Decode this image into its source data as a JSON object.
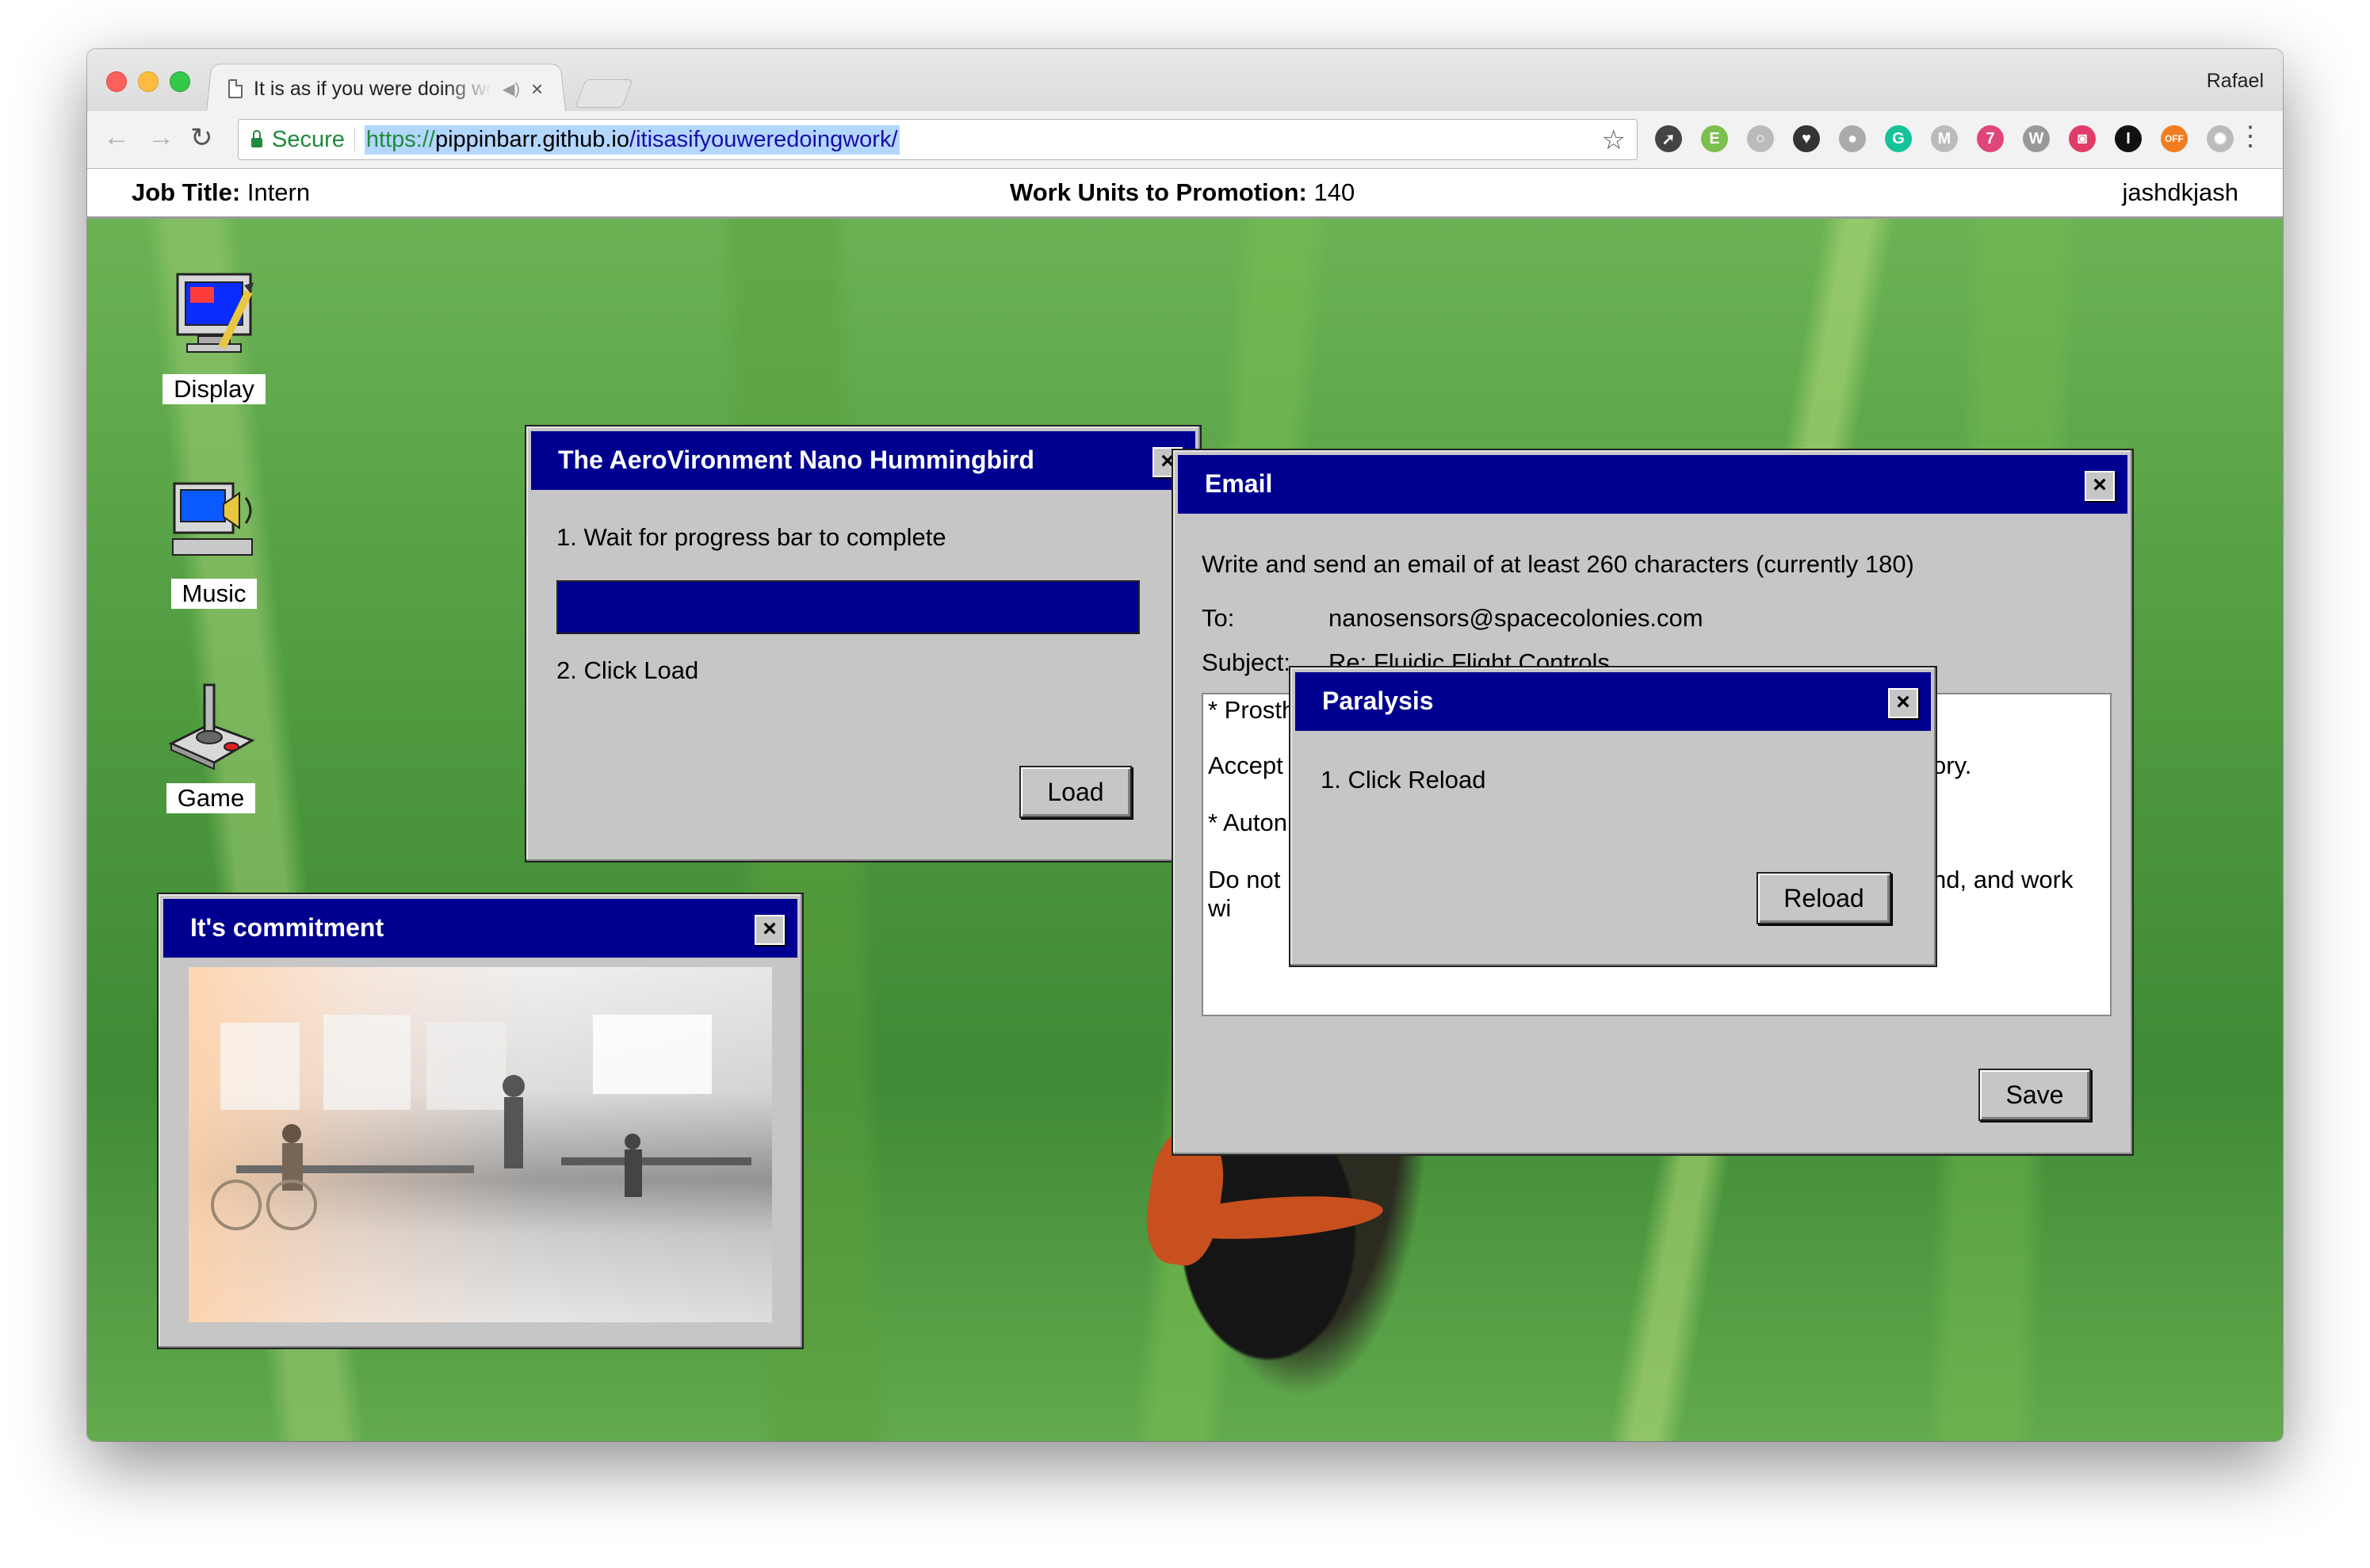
{
  "browser": {
    "tab_title": "It is as if you were doing work",
    "tab_close": "×",
    "profile_name": "Rafael",
    "secure_label": "Secure",
    "url_scheme": "https://",
    "url_host": "pippinbarr.github.io",
    "url_path": "/itisasifyouweredoingwork/",
    "extensions": [
      {
        "name": "rocket-icon",
        "color": "#444444",
        "glyph": "➚"
      },
      {
        "name": "evernote-icon",
        "color": "#7bbf4c",
        "glyph": "E"
      },
      {
        "name": "circle-ext-icon",
        "color": "#bbbbbb",
        "glyph": "○"
      },
      {
        "name": "pocket-icon",
        "color": "#333333",
        "glyph": "♥"
      },
      {
        "name": "dot-ext-icon",
        "color": "#aaaaaa",
        "glyph": "●"
      },
      {
        "name": "grammarly-icon",
        "color": "#15c39a",
        "glyph": "G"
      },
      {
        "name": "m-ext-icon",
        "color": "#bbbbbb",
        "glyph": "M"
      },
      {
        "name": "seven-ext-icon",
        "color": "#e0457b",
        "glyph": "7"
      },
      {
        "name": "wikipedia-icon",
        "color": "#999999",
        "glyph": "W"
      },
      {
        "name": "camera-ext-icon",
        "color": "#e03c67",
        "glyph": "◙"
      },
      {
        "name": "instapaper-icon",
        "color": "#111111",
        "glyph": "I"
      },
      {
        "name": "off-ext-icon",
        "color": "#f07d20",
        "glyph": "OFF"
      },
      {
        "name": "gear-ext-icon",
        "color": "#bbbbbb",
        "glyph": "✺"
      }
    ]
  },
  "status": {
    "job_title_label": "Job Title:",
    "job_title": "Intern",
    "units_label": "Work Units to Promotion:",
    "units_value": "140",
    "username": "jashdkjash"
  },
  "desktop_icons": [
    {
      "label": "Display"
    },
    {
      "label": "Music"
    },
    {
      "label": "Game"
    }
  ],
  "windows": {
    "hummingbird": {
      "title": "The AeroVironment Nano Hummingbird",
      "step1": "1. Wait for progress bar to complete",
      "progress": 1.0,
      "step2": "2. Click Load",
      "button": "Load"
    },
    "email": {
      "title": "Email",
      "instructions": "Write and send an email of at least 260 characters (currently 180)",
      "to_label": "To:",
      "to_value": "nanosensors@spacecolonies.com",
      "subject_label": "Subject:",
      "subject_value": "Re: Fluidic Flight Controls",
      "body_line1": "* Prosth",
      "body_line2a": "Accept",
      "body_line2b": "ory.",
      "body_line3": "* Auton",
      "body_line4a": "Do not",
      "body_line4b": "nd, and work",
      "body_line5": "wi",
      "button": "Save"
    },
    "paralysis": {
      "title": "Paralysis",
      "step1": "1. Click Reload",
      "button": "Reload"
    },
    "commitment": {
      "title": "It's commitment"
    }
  },
  "close_glyph": "×"
}
